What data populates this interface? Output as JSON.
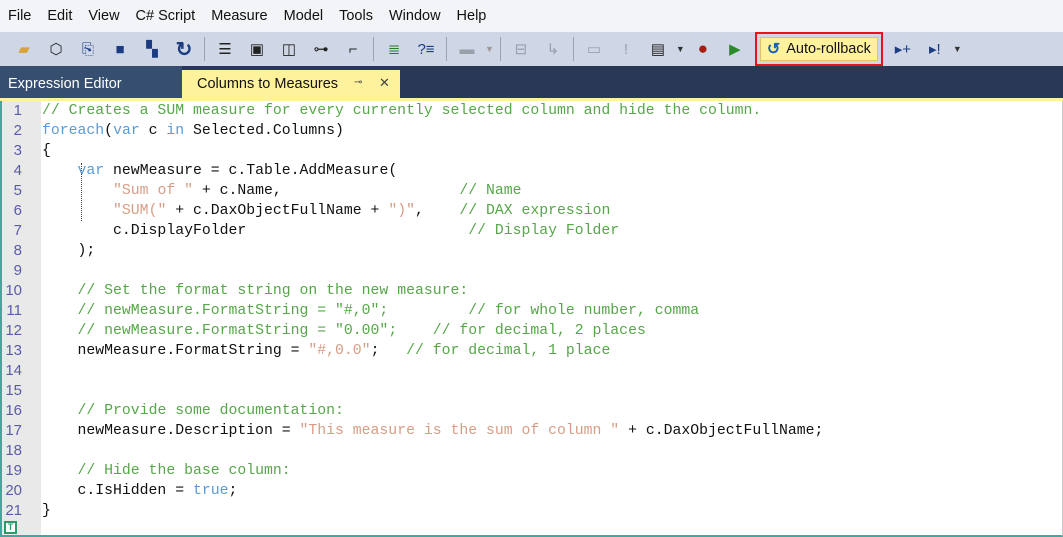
{
  "menu": [
    "File",
    "Edit",
    "View",
    "C# Script",
    "Measure",
    "Model",
    "Tools",
    "Window",
    "Help"
  ],
  "toolbar": {
    "auto_rollback_label": "Auto-rollback"
  },
  "tabs": {
    "expression_editor": "Expression Editor",
    "columns_to_measures": "Columns to Measures",
    "pin": "⊸",
    "close": "✕"
  },
  "colors": {
    "comment": "#57a64a",
    "keyword": "#5b9bd5",
    "string": "#d69d85",
    "active_tab": "#fff29d",
    "highlight_border": "#e8131b"
  },
  "code": [
    [
      [
        "comment",
        "// Creates a SUM measure for every currently selected column and hide the column."
      ]
    ],
    [
      [
        "kw",
        "foreach"
      ],
      [
        "plain",
        "("
      ],
      [
        "kw",
        "var"
      ],
      [
        "plain",
        " c "
      ],
      [
        "kw",
        "in"
      ],
      [
        "plain",
        " Selected.Columns)"
      ]
    ],
    [
      [
        "plain",
        "{"
      ]
    ],
    [
      [
        "plain",
        "    "
      ],
      [
        "kw",
        "var"
      ],
      [
        "plain",
        " newMeasure = c.Table.AddMeasure("
      ]
    ],
    [
      [
        "plain",
        "        "
      ],
      [
        "str",
        "\"Sum of \""
      ],
      [
        "plain",
        " + c.Name,                    "
      ],
      [
        "comment",
        "// Name"
      ]
    ],
    [
      [
        "plain",
        "        "
      ],
      [
        "str",
        "\"SUM(\""
      ],
      [
        "plain",
        " + c.DaxObjectFullName + "
      ],
      [
        "str",
        "\")\""
      ],
      [
        "plain",
        ",    "
      ],
      [
        "comment",
        "// DAX expression"
      ]
    ],
    [
      [
        "plain",
        "        c.DisplayFolder                         "
      ],
      [
        "comment",
        "// Display Folder"
      ]
    ],
    [
      [
        "plain",
        "    );"
      ]
    ],
    [],
    [
      [
        "plain",
        "    "
      ],
      [
        "comment",
        "// Set the format string on the new measure:"
      ]
    ],
    [
      [
        "plain",
        "    "
      ],
      [
        "comment",
        "// newMeasure.FormatString = \"#,0\";         // for whole number, comma"
      ]
    ],
    [
      [
        "plain",
        "    "
      ],
      [
        "comment",
        "// newMeasure.FormatString = \"0.00\";    // for decimal, 2 places"
      ]
    ],
    [
      [
        "plain",
        "    newMeasure.FormatString = "
      ],
      [
        "str",
        "\"#,0.0\""
      ],
      [
        "plain",
        ";   "
      ],
      [
        "comment",
        "// for decimal, 1 place"
      ]
    ],
    [],
    [],
    [
      [
        "plain",
        "    "
      ],
      [
        "comment",
        "// Provide some documentation:"
      ]
    ],
    [
      [
        "plain",
        "    newMeasure.Description = "
      ],
      [
        "str",
        "\"This measure is the sum of column \""
      ],
      [
        "plain",
        " + c.DaxObjectFullName;"
      ]
    ],
    [],
    [
      [
        "plain",
        "    "
      ],
      [
        "comment",
        "// Hide the base column:"
      ]
    ],
    [
      [
        "plain",
        "    c.IsHidden = "
      ],
      [
        "kw",
        "true"
      ],
      [
        "plain",
        ";"
      ]
    ],
    [
      [
        "plain",
        "}"
      ]
    ]
  ]
}
